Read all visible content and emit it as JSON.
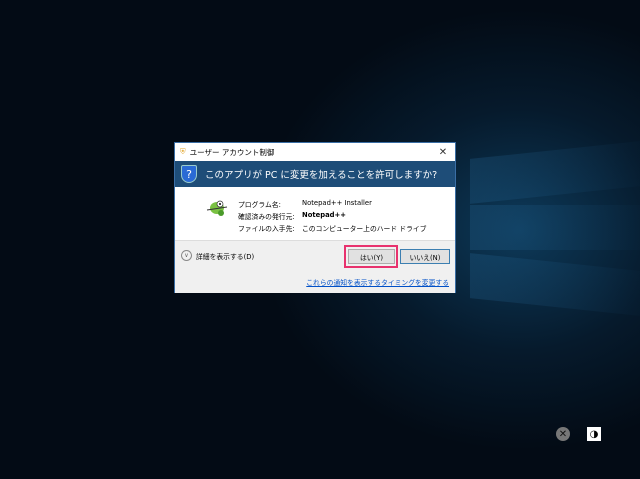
{
  "dialog": {
    "title": "ユーザー アカウント制御",
    "close": "✕",
    "question": "このアプリが PC に変更を加えることを許可しますか?",
    "fields": [
      {
        "label": "プログラム名:",
        "value": "Notepad++ Installer"
      },
      {
        "label": "確認済みの発行元:",
        "value": "Notepad++"
      },
      {
        "label": "ファイルの入手先:",
        "value": "このコンピューター上のハード ドライブ"
      }
    ],
    "show_details": "詳細を表示する(D)",
    "yes": "はい(Y)",
    "no": "いいえ(N)",
    "link": "これらの通知を表示するタイミングを変更する"
  },
  "colors": {
    "header": "#1e4d78",
    "highlight": "#e8326e",
    "link": "#0050c8"
  }
}
